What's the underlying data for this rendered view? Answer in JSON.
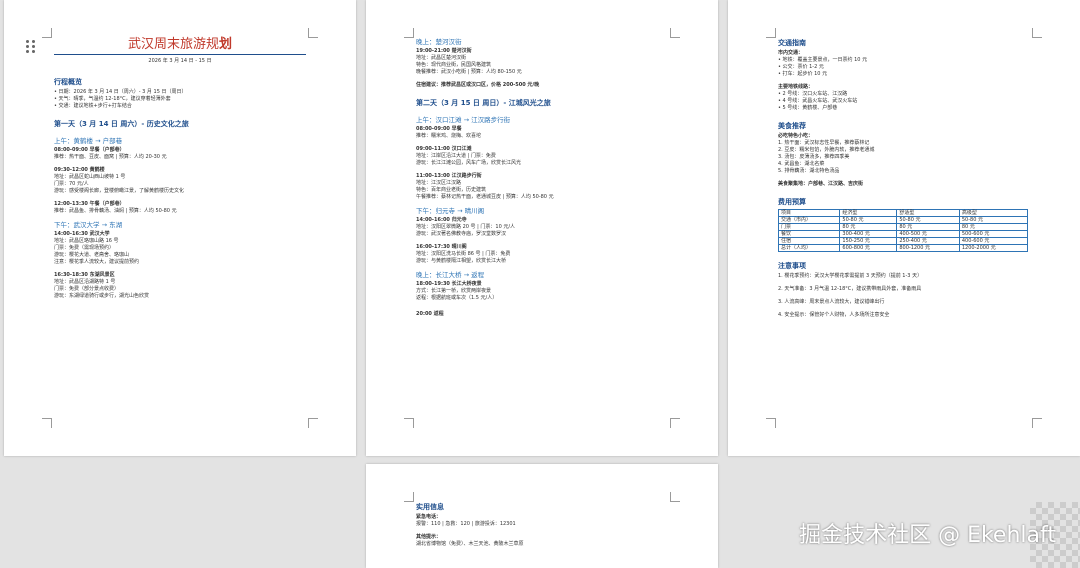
{
  "page1": {
    "title_main": "武汉周末旅游规",
    "title_bold": "划",
    "date": "2026 年 3 月 14 日 - 15 日",
    "overview": {
      "heading": "行程概览",
      "lines": [
        "• 日期：2026 年 3 月 14 日（周六）- 3 月 15 日（周日）",
        "• 天气：晴季，气温约 12-18°C，建议穿着轻薄外套",
        "• 交通：建议地铁+步行+打车结合"
      ]
    },
    "day1": {
      "heading": "第一天（3 月 14 日 周六）- 历史文化之旅",
      "morning": {
        "heading": "上午：黄鹤楼 → 户部巷",
        "blocks": [
          [
            "08:00-09:00 早餐（户部巷）",
            "推荐：热干面、豆皮、面窝 | 预算：人均 20-30 元"
          ],
          [
            "09:30-12:00 黄鹤楼",
            "地址：武昌区蛇山西山坡特 1 号",
            "门票：70 元/人",
            "游玩：感受楼阁长廊，登楼俯瞰江景，了解黄鹤楼历史文化"
          ],
          [
            "12:00-13:30 午餐（户部巷）",
            "推荐：武昌鱼、排骨藕汤、油焖 | 预算：人均 50-80 元"
          ]
        ]
      },
      "afternoon": {
        "heading": "下午：武汉大学 → 东湖",
        "blocks": [
          [
            "14:00-16:30 武汉大学",
            "地址：武昌区珞珈山路 16 号",
            "门票：免费（需现场预约）",
            "游玩：樱花大道、老斋舍、珞珈山",
            "注意：樱花季人流较大，建议提前预约"
          ],
          [
            "16:30-18:30 东湖风景区",
            "地址：武昌区沿湖路特 1 号",
            "门票：免费（部分景点收费）",
            "游玩：东湖绿道骑行或步行，湖光山色欣赏"
          ]
        ]
      }
    }
  },
  "page2": {
    "evening1": {
      "heading": "晚上：楚河汉街",
      "lines": [
        "19:00-21:00 楚河汉街",
        "地址：武昌区楚河汉街",
        "特色：现代商业街，民国风格建筑",
        "晚餐推荐：武汉小吃街 | 预算：人均 80-150 元"
      ],
      "stay": "住宿建议：推荐武昌区或汉口区，价格 200-500 元/晚"
    },
    "day2": {
      "heading": "第二天（3 月 15 日 周日）- 江城风光之旅",
      "morning": {
        "heading": "上午：汉口江滩 → 江汉路步行街",
        "blocks": [
          [
            "08:00-09:00 早餐",
            "推荐：糯米鸡、烧梅、欢喜坨"
          ],
          [
            "09:00-11:00 汉口江滩",
            "地址：江岸区沿江大道 | 门票：免费",
            "游玩：长江江滩公园，风车广场，欣赏长江风光"
          ],
          [
            "11:00-13:00 江汉路步行街",
            "地址：江汉区江汉路",
            "特色：百年商业老街，历史建筑",
            "午餐推荐：蔡林记热干面，老通城豆皮 | 预算：人均 50-80 元"
          ]
        ]
      },
      "afternoon": {
        "heading": "下午：归元寺 → 晴川阁",
        "blocks": [
          [
            "14:00-16:00 归元寺",
            "地址：汉阳区翠微路 20 号 | 门票：10 元/人",
            "游玩：武汉著名佛教寺庙，罗汉堂数罗汉"
          ],
          [
            "16:00-17:30 晴川阁",
            "地址：汉阳区洗马长街 86 号 | 门票：免费",
            "游玩：与黄鹤楼隔江相望，欣赏长江大桥"
          ]
        ]
      },
      "evening": {
        "heading": "晚上：长江大桥 → 返程",
        "blocks": [
          [
            "18:00-19:30 长江大桥夜景",
            "方式：长江第一桥，欣赏两岸夜景",
            "返程：根据航班或车次（1.5 元/人）"
          ],
          [
            "20:00 返程"
          ]
        ]
      }
    }
  },
  "page3": {
    "traffic": {
      "heading": "交通指南",
      "city_label": "市内交通：",
      "city": [
        "• 地铁：覆盖主要景点，一日票约 10 元",
        "• 公交：票价 1-2 元",
        "• 打车：起步价 10 元"
      ],
      "station_label": "主要地铁线路：",
      "stations": [
        "• 2 号线：汉口火车站、江汉路",
        "• 4 号线：武昌火车站、武汉火车站",
        "• 5 号线：黄鹤楼、户部巷"
      ]
    },
    "food": {
      "heading": "美食推荐",
      "must_label": "必吃特色小吃：",
      "items": [
        "1. 热干面：武汉标志性早餐，推荐蔡林记",
        "2. 豆皮：糯米包馅，外脆内软，推荐老通城",
        "3. 汤包：皮薄汤多，推荐四季美",
        "4. 武昌鱼：湖北名菜",
        "5. 排骨藕汤：湖北特色汤品"
      ],
      "area": "美食聚集地：户部巷、江汉路、吉庆街"
    },
    "budget": {
      "heading": "费用预算",
      "headers": [
        "项目",
        "经济型",
        "舒适型",
        "高级型"
      ],
      "rows": [
        [
          "交通（市内）",
          "50-80 元",
          "50-80 元",
          "50-80 元"
        ],
        [
          "门票",
          "80 元",
          "80 元",
          "80 元"
        ],
        [
          "餐饮",
          "300-400 元",
          "400-500 元",
          "500-600 元"
        ],
        [
          "住宿",
          "150-250 元",
          "250-400 元",
          "400-600 元"
        ],
        [
          "总计（人均）",
          "600-800 元",
          "800-1200 元",
          "1200-2000 元"
        ]
      ]
    },
    "notes": {
      "heading": "注意事项",
      "items": [
        "1. 樱花季预约：武汉大学樱花季需提前 3 天预约（提前 1-3 天）",
        "2. 天气准备：3 月气温 12-18°C，建议携带雨具外套，准备雨具",
        "3. 人流高峰：周末景点人流较大，建议错峰出行",
        "4. 安全提示：保管好个人财物，人多场所注意安全"
      ]
    }
  },
  "page4": {
    "heading": "实用信息",
    "phone_label": "紧急电话：",
    "phones": "报警：110 | 急救：120 | 旅游投诉：12301",
    "tips_label": "其他提示：",
    "tips": "湖北省博物馆（免费）、木兰天池、黄陂木兰草原"
  },
  "watermark": "掘金技术社区 @ Ekehlaft"
}
